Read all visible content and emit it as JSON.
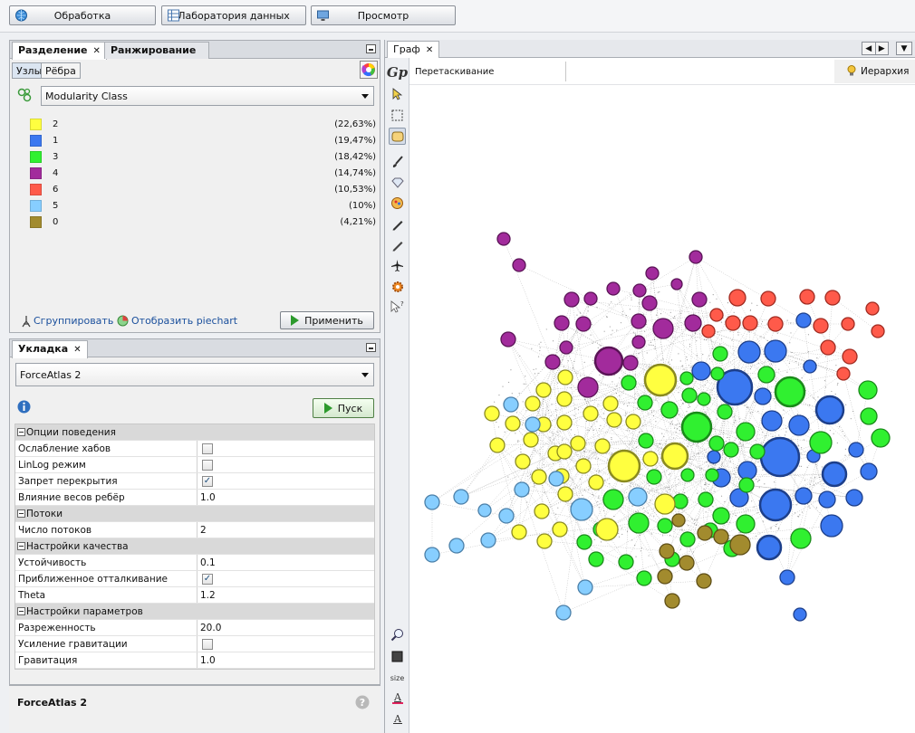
{
  "workspace": {
    "tabs": [
      {
        "label": "Обработка",
        "icon": "globe-icon"
      },
      {
        "label": "Лаборатория данных",
        "icon": "table-icon"
      },
      {
        "label": "Просмотр",
        "icon": "monitor-icon"
      }
    ]
  },
  "partition": {
    "tabs": [
      "Разделение",
      "Ранжирование"
    ],
    "subtabs": [
      "Узлы",
      "Рёбра"
    ],
    "attribute": "Modularity Class",
    "legend": [
      {
        "label": "2",
        "pct": "(22,63%)",
        "color": "#ffff40"
      },
      {
        "label": "1",
        "pct": "(19,47%)",
        "color": "#3b78f0"
      },
      {
        "label": "3",
        "pct": "(18,42%)",
        "color": "#30f030"
      },
      {
        "label": "4",
        "pct": "(14,74%)",
        "color": "#a22b9c"
      },
      {
        "label": "6",
        "pct": "(10,53%)",
        "color": "#ff5a4a"
      },
      {
        "label": "5",
        "pct": "(10%)",
        "color": "#87ceff"
      },
      {
        "label": "0",
        "pct": "(4,21%)",
        "color": "#a28b2e"
      }
    ],
    "group_link": "Сгруппировать",
    "piechart_link": "Отобразить piechart",
    "apply_button": "Применить"
  },
  "layout": {
    "tab": "Укладка",
    "algorithm": "ForceAtlas 2",
    "run_button": "Пуск",
    "properties": [
      {
        "type": "category",
        "label": "Опции поведения"
      },
      {
        "type": "check",
        "label": "Ослабление хабов",
        "checked": false
      },
      {
        "type": "check",
        "label": "LinLog режим",
        "checked": false
      },
      {
        "type": "check",
        "label": "Запрет перекрытия",
        "checked": true
      },
      {
        "type": "text",
        "label": "Влияние весов ребёр",
        "value": "1.0"
      },
      {
        "type": "category",
        "label": "Потоки"
      },
      {
        "type": "text",
        "label": "Число потоков",
        "value": "2"
      },
      {
        "type": "category",
        "label": "Настройки качества"
      },
      {
        "type": "text",
        "label": "Устойчивость",
        "value": "0.1"
      },
      {
        "type": "check",
        "label": "Приближенное отталкивание",
        "checked": true
      },
      {
        "type": "text",
        "label": "Theta",
        "value": "1.2"
      },
      {
        "type": "category",
        "label": "Настройки параметров"
      },
      {
        "type": "text",
        "label": "Разреженность",
        "value": "20.0"
      },
      {
        "type": "check",
        "label": "Усиление гравитации",
        "checked": false
      },
      {
        "type": "text",
        "label": "Гравитация",
        "value": "1.0"
      }
    ],
    "footer_title": "ForceAtlas 2"
  },
  "graph": {
    "tab": "Граф",
    "mode": "Перетаскивание",
    "hierarchy_label": "Иерархия",
    "size_label": "size"
  }
}
